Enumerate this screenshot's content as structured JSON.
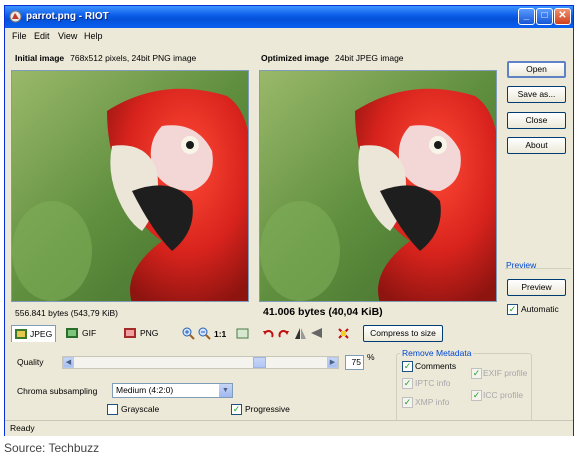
{
  "window": {
    "title": "parrot.png - RIOT"
  },
  "menu": [
    {
      "label": "File"
    },
    {
      "label": "Edit"
    },
    {
      "label": "View"
    },
    {
      "label": "Help"
    }
  ],
  "initial": {
    "label": "Initial image",
    "info": "768x512 pixels, 24bit PNG image",
    "size": "556.841 bytes (543,79 KiB)"
  },
  "optimized": {
    "label": "Optimized image",
    "info": "24bit JPEG image",
    "size": "41.006 bytes (40,04 KiB)"
  },
  "buttons": {
    "open": "Open",
    "save_as": "Save as...",
    "close": "Close",
    "about": "About"
  },
  "preview": {
    "title": "Preview",
    "button": "Preview",
    "automatic_label": "Automatic",
    "automatic_checked": true
  },
  "formats": {
    "jpeg": "JPEG",
    "gif": "GIF",
    "png": "PNG",
    "selected": "JPEG"
  },
  "toolbar": {
    "zoom_1_1": "1:1",
    "compress_to_size": "Compress to size"
  },
  "quality": {
    "label": "Quality",
    "value": "75",
    "unit": "%"
  },
  "chroma": {
    "label": "Chroma subsampling",
    "value": "Medium (4:2:0)"
  },
  "options": {
    "grayscale": "Grayscale",
    "grayscale_checked": false,
    "progressive": "Progressive",
    "progressive_checked": true
  },
  "metadata": {
    "title": "Remove Metadata",
    "comments": "Comments",
    "comments_checked": true,
    "exif": "EXIF profile",
    "iptc": "IPTC info",
    "icc": "ICC profile",
    "xmp": "XMP info",
    "disabled_checked": true
  },
  "status": "Ready",
  "caption": "Source: Techbuzz",
  "icons": [
    "app-icon",
    "minimize-icon",
    "maximize-icon",
    "close-icon",
    "zoom-in-icon",
    "zoom-out-icon",
    "fit-icon",
    "rotate-left-icon",
    "rotate-right-icon",
    "flip-horizontal-icon",
    "flip-vertical-icon",
    "transparency-icon"
  ],
  "colors": {
    "titlebar": "#0a5be8",
    "window_bg": "#ece9d8",
    "parrot_red": "#d8231d",
    "background_green": "#5a8a38",
    "group_title": "#0046d5"
  }
}
